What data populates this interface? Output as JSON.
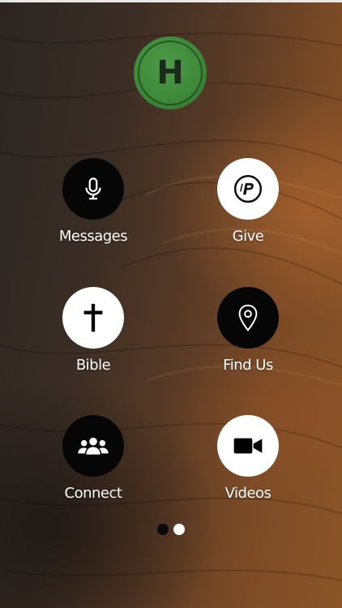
{
  "app": {
    "logo_letter": "H",
    "logo_color": "#3e8a3a"
  },
  "menu": {
    "items": [
      {
        "label": "Messages",
        "icon": "microphone-icon",
        "style": "dark"
      },
      {
        "label": "Give",
        "icon": "pushpay-icon",
        "style": "light"
      },
      {
        "label": "Bible",
        "icon": "cross-icon",
        "style": "light"
      },
      {
        "label": "Find Us",
        "icon": "map-pin-icon",
        "style": "dark"
      },
      {
        "label": "Connect",
        "icon": "group-icon",
        "style": "dark"
      },
      {
        "label": "Videos",
        "icon": "video-camera-icon",
        "style": "light"
      }
    ]
  },
  "pager": {
    "pages": 2,
    "current": 2
  }
}
